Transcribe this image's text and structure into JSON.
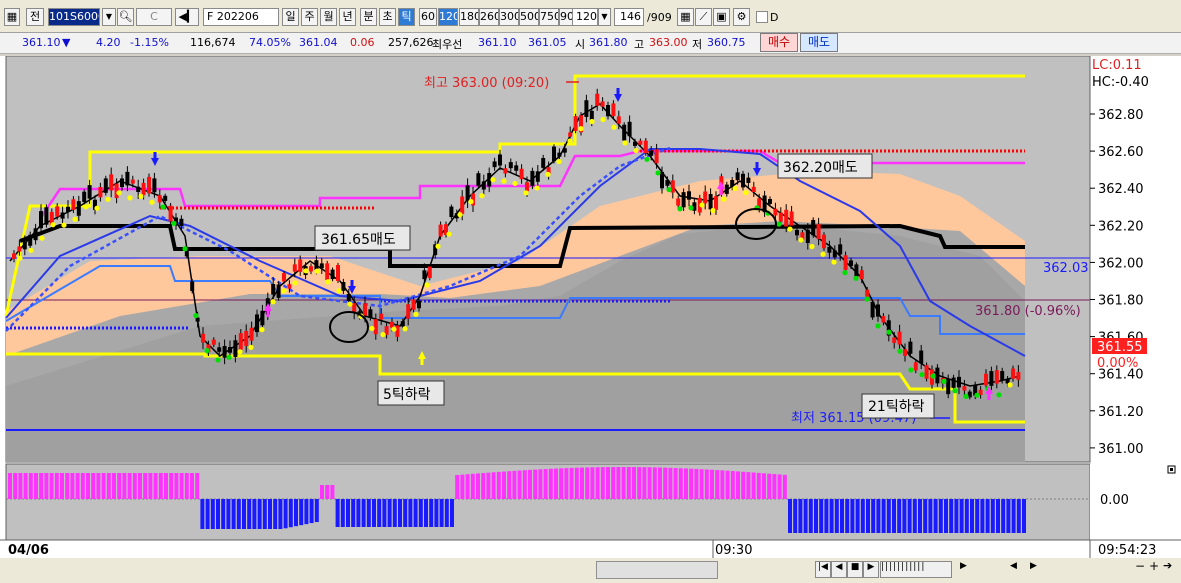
{
  "toolbar": {
    "tab_main": "전",
    "code": "101S6000",
    "search_icon": "search-icon",
    "compare": "C",
    "product": "F 202206",
    "period_day": "일",
    "period_week": "주",
    "period_month": "월",
    "period_year": "년",
    "period_min": "분",
    "period_sec": "초",
    "period_tick": "틱",
    "tick_options": [
      "60",
      "120",
      "180",
      "260",
      "300",
      "500",
      "750",
      "900"
    ],
    "tick_value": "120",
    "count": "146",
    "count_total": "/909",
    "checkbox_label": "D"
  },
  "quote": {
    "price": "361.10",
    "change": "4.20",
    "change_pct": "-1.15%",
    "volume": "116,674",
    "vol_pct": "74.05%",
    "bid": "361.04",
    "spread": "0.06",
    "open_interest": "257,626",
    "best_label": "최우선",
    "best_bid": "361.10",
    "best_ask": "361.05",
    "high_label": "시",
    "open": "361.80",
    "high_label2": "고",
    "high": "363.00",
    "low_label": "저",
    "low": "360.75",
    "buy_button": "매수",
    "sell_button": "매도"
  },
  "chart": {
    "lc": "LC:0.11",
    "hc": "HC:-0.40",
    "y_ticks": [
      "362.80",
      "362.60",
      "362.40",
      "362.20",
      "362.00",
      "361.80",
      "361.60",
      "361.40",
      "361.20",
      "361.00"
    ],
    "level_blue": "362.03",
    "level_purple": "361.80 (-0.96%)",
    "current_price": "361.55",
    "current_pct": "0.00%",
    "high_annot": "최고 363.00 (09:20)",
    "low_annot": "최저 361.15 (09:47)",
    "box1": "361.65매도",
    "box2": "362.20매도",
    "box3": "5틱하락",
    "box4": "21틱하락",
    "osc_zero": "0.00",
    "x_left": "04/06",
    "x_mid": "09:30",
    "x_right": "09:54:23",
    "colors": {
      "pink": "#ff33ff",
      "blue": "#1a1aff",
      "yellow": "#ffff00",
      "red": "#ff0000"
    }
  }
}
